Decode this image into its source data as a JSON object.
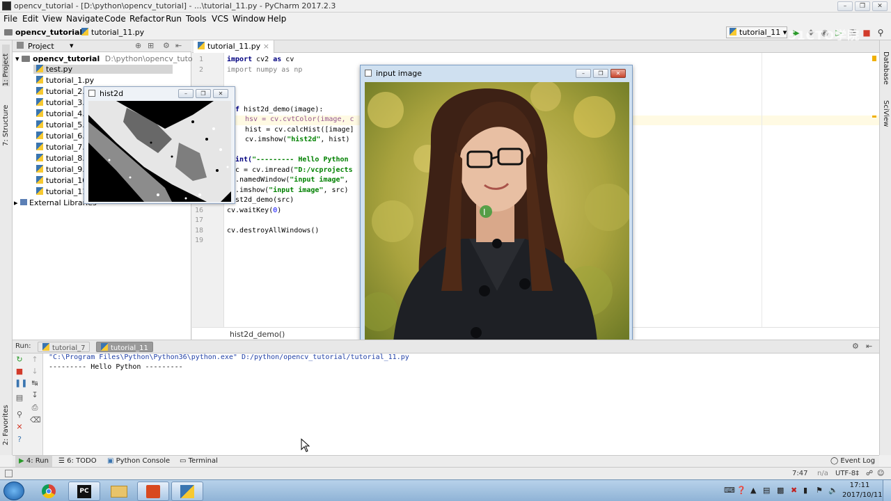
{
  "window": {
    "title": "opencv_tutorial - [D:\\python\\opencv_tutorial] - ...\\tutorial_11.py - PyCharm 2017.2.3",
    "minimize_icon": "minimize-icon",
    "restore_icon": "restore-icon",
    "close_icon": "close-icon"
  },
  "menu": [
    "File",
    "Edit",
    "View",
    "Navigate",
    "Code",
    "Refactor",
    "Run",
    "Tools",
    "VCS",
    "Window",
    "Help"
  ],
  "nav": {
    "project": "opencv_tutorial",
    "file": "tutorial_11.py",
    "run_config": "tutorial_11",
    "watermark": "51CTO学院"
  },
  "left_stripe": {
    "project_tab": "1: Project",
    "structure_tab": "7: Structure",
    "favorites_tab": "2: Favorites"
  },
  "right_stripe": {
    "database_tab": "Database",
    "sciview_tab": "SciView"
  },
  "project_panel": {
    "header": "Project",
    "root_name": "opencv_tutorial",
    "root_path": "D:\\python\\opencv_tutorial",
    "files": [
      "test.py",
      "tutorial_1.py",
      "tutorial_2.",
      "tutorial_3.",
      "tutorial_4.",
      "tutorial_5.",
      "tutorial_6.",
      "tutorial_7.",
      "tutorial_8.",
      "tutorial_9.",
      "tutorial_10",
      "tutorial_11"
    ],
    "external": "External Libraries"
  },
  "editor": {
    "tab": "tutorial_11.py",
    "line_numbers": [
      "1",
      "2",
      "",
      "",
      "",
      "",
      "",
      "",
      "",
      "",
      "",
      "",
      "",
      "",
      "",
      "16",
      "17",
      "18",
      "19"
    ],
    "breadcrumb": "hist2d_demo()"
  },
  "code": {
    "l1_kw": "import",
    "l1_rest": " cv2 ",
    "l1_as": "as",
    "l1_name": " cv",
    "l2": "import numpy as np",
    "l5_kw": "f",
    "l5_rest": " hist2d_demo(image):",
    "l6": "hsv = cv.cvtColor(image, c",
    "l7": "hist = cv.calcHist([image]",
    "l8_a": "cv.imshow(",
    "l8_str": "\"hist2d\"",
    "l8_b": ", hist)",
    "l10_a": "int(",
    "l10_str": "\"--------- Hello Python",
    "l11_a": "c = cv.imread(",
    "l11_str": "\"D:/vcprojects",
    "l12_a": ".namedWindow(",
    "l12_str": "\"input image\"",
    "l12_b": ",",
    "l13_a": ".imshow(",
    "l13_str": "\"input image\"",
    "l13_b": ", src)",
    "l14": "st2d_demo(src)",
    "l16_a": "cv.waitKey(",
    "l16_num": "0",
    "l16_b": ")",
    "l18": "cv.destroyAllWindows()"
  },
  "hist2d_window": {
    "title": "hist2d"
  },
  "image_window": {
    "title": "input image"
  },
  "run_panel": {
    "label": "Run:",
    "tabs": [
      "tutorial_7",
      "tutorial_11"
    ],
    "output_line1": "\"C:\\Program Files\\Python\\Python36\\python.exe\" D:/python/opencv_tutorial/tutorial_11.py",
    "output_line2": "--------- Hello Python ---------"
  },
  "tool_strip": {
    "run": "4: Run",
    "todo": "6: TODO",
    "console": "Python Console",
    "terminal": "Terminal",
    "event_log": "Event Log"
  },
  "status": {
    "position": "7:47",
    "na": "n/a",
    "encoding": "UTF-8‡"
  },
  "taskbar": {
    "time": "17:11",
    "date": "2017/10/11"
  }
}
